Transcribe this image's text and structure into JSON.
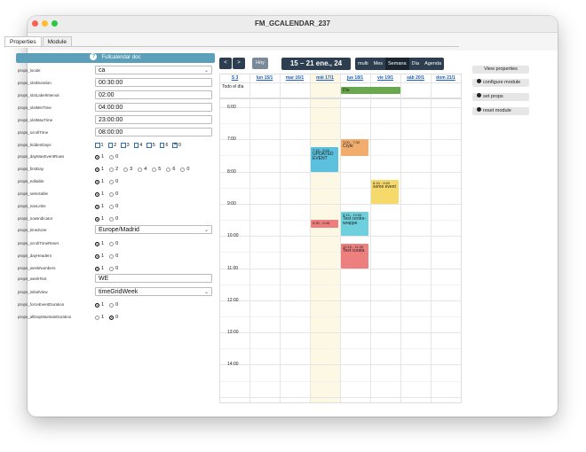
{
  "window": {
    "title": "FM_GCALENDAR_237"
  },
  "tabs": [
    {
      "label": "Properties"
    },
    {
      "label": "Module"
    }
  ],
  "doc_button": {
    "label": "Fullcalendar doc",
    "icon": "question-circle-icon"
  },
  "props": {
    "locale": {
      "label": "props_locale",
      "value": "ca"
    },
    "slotDuration": {
      "label": "props_slotDuration",
      "value": "00:30:00"
    },
    "slotLabelInterval": {
      "label": "props_slotLabelInterval",
      "value": "02:00"
    },
    "slotMinTime": {
      "label": "props_slotMinTime",
      "value": "04:00:00"
    },
    "slotMaxTime": {
      "label": "props_slotMaxTime",
      "value": "23:00:00"
    },
    "scrollTime": {
      "label": "props_scrollTime",
      "value": "08:00:00"
    },
    "hiddenDays": {
      "label": "props_hiddenDays",
      "options": [
        "1",
        "2",
        "3",
        "4",
        "5",
        "6",
        "0"
      ],
      "checked": "0"
    },
    "dayMaxEventRows": {
      "label": "props_dayMaxEventRows",
      "options": [
        "1",
        "0"
      ],
      "selected": "1"
    },
    "firstDay": {
      "label": "props_firstDay",
      "options": [
        "1",
        "2",
        "3",
        "4",
        "5",
        "6",
        "0"
      ],
      "selected": "1"
    },
    "editable": {
      "label": "props_editable",
      "options": [
        "1",
        "0"
      ],
      "selected": "1"
    },
    "selectable": {
      "label": "props_selectable",
      "options": [
        "1",
        "0"
      ],
      "selected": "1"
    },
    "navLinks": {
      "label": "props_navLinks",
      "options": [
        "1",
        "0"
      ],
      "selected": "1"
    },
    "nowIndicator": {
      "label": "props_nowIndicator",
      "options": [
        "1",
        "0"
      ],
      "selected": "1"
    },
    "timeZone": {
      "label": "props_timeZone",
      "value": "Europe/Madrid"
    },
    "scrollTimeReset": {
      "label": "props_scrollTimeReset",
      "options": [
        "1",
        "0"
      ],
      "selected": "1"
    },
    "dayHeaders": {
      "label": "props_dayHeaders",
      "options": [
        "1",
        "0"
      ],
      "selected": "1"
    },
    "weekNumbers": {
      "label": "props_weekNumbers",
      "options": [
        "1",
        "0"
      ],
      "selected": "1"
    },
    "weekText": {
      "label": "props_weekText",
      "value": "WE"
    },
    "initialView": {
      "label": "props_initialView",
      "value": "timeGridWeek"
    },
    "forceEventDuration": {
      "label": "props_forceEventDuration",
      "options": [
        "1",
        "0"
      ],
      "selected": "1"
    },
    "allDayMaintainDuration": {
      "label": "props_allDayMaintainDuration",
      "options": [
        "1",
        "0"
      ],
      "selected": "0"
    }
  },
  "calendar": {
    "prev_label": "<",
    "next_label": ">",
    "today_label": "Hoy",
    "title": "15 – 21 ene., 24",
    "views": [
      "multi",
      "Mes",
      "Semana",
      "Día",
      "Agenda"
    ],
    "active_view": "Semana",
    "week_label": "S 3",
    "days": [
      "lun 15/1",
      "mar 16/1",
      "mié 17/1",
      "jue 18/1",
      "vie 19/1",
      "sáb 20/1",
      "dom 21/1"
    ],
    "allday_label": "Todo el día",
    "hours": [
      "6:00",
      "7:00",
      "8:00",
      "9:00",
      "10:00",
      "11:00",
      "12:00",
      "13:00",
      "14:00"
    ],
    "allday_events": [
      {
        "day": 3,
        "title": "Dia",
        "color": "#6aa84f"
      }
    ],
    "events": [
      {
        "day": 2,
        "time": "7:15 - 8:00",
        "title": "UPDATED EVENT",
        "color": "#5bc0de",
        "start": 7.25,
        "end": 8.0
      },
      {
        "day": 3,
        "time": "7:00 - 7:30",
        "title": "Cryle",
        "color": "#f0ad6e",
        "start": 7.0,
        "end": 7.5
      },
      {
        "day": 4,
        "time": "8:15 - 9:00",
        "title": "some event",
        "color": "#f5d96b",
        "start": 8.25,
        "end": 9.0
      },
      {
        "day": 3,
        "time": "9:15 - 10:00",
        "title": "Test centre-wrappe",
        "color": "#6ed0dc",
        "start": 9.25,
        "end": 10.0
      },
      {
        "day": 2,
        "time": "9:30 - 9:45",
        "title": "",
        "color": "#ee7f7f",
        "start": 9.5,
        "end": 9.75
      },
      {
        "day": 3,
        "time": "10:15 - 11:00",
        "title": "Test curata",
        "color": "#ee7f7f",
        "start": 10.25,
        "end": 11.0
      }
    ]
  },
  "right_panel": {
    "view_properties": "View properties",
    "configure_module": "configure module",
    "set_props": "set props",
    "reset_module": "reset module"
  },
  "colors": {
    "accent": "#5b9fb8",
    "cal_header": "#2c3e50",
    "today_bg": "#fcf8e3"
  }
}
